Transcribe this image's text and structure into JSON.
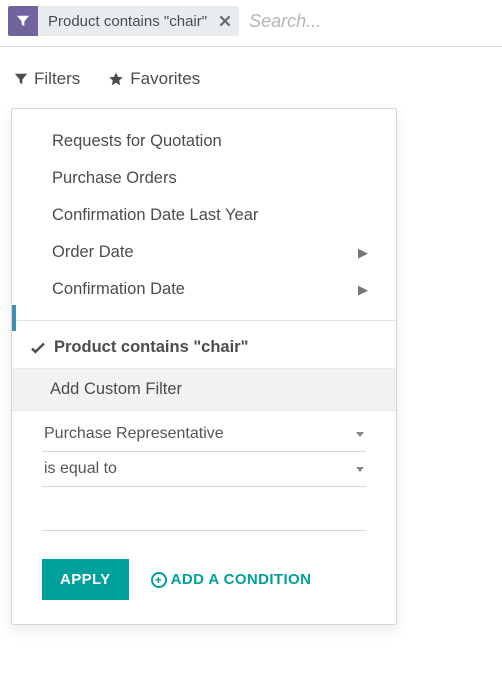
{
  "search": {
    "facet_label": "Product contains \"chair\"",
    "placeholder": "Search..."
  },
  "toolbar": {
    "filters_label": "Filters",
    "favorites_label": "Favorites"
  },
  "filters_menu": {
    "items": [
      {
        "label": "Requests for Quotation",
        "has_submenu": false
      },
      {
        "label": "Purchase Orders",
        "has_submenu": false
      },
      {
        "label": "Confirmation Date Last Year",
        "has_submenu": false
      },
      {
        "label": "Order Date",
        "has_submenu": true
      },
      {
        "label": "Confirmation Date",
        "has_submenu": true
      }
    ],
    "active_filter_label": "Product contains \"chair\"",
    "custom_section_label": "Add Custom Filter",
    "field_select_value": "Purchase Representative",
    "operator_select_value": "is equal to",
    "apply_label": "APPLY",
    "add_condition_label": "ADD A CONDITION"
  }
}
